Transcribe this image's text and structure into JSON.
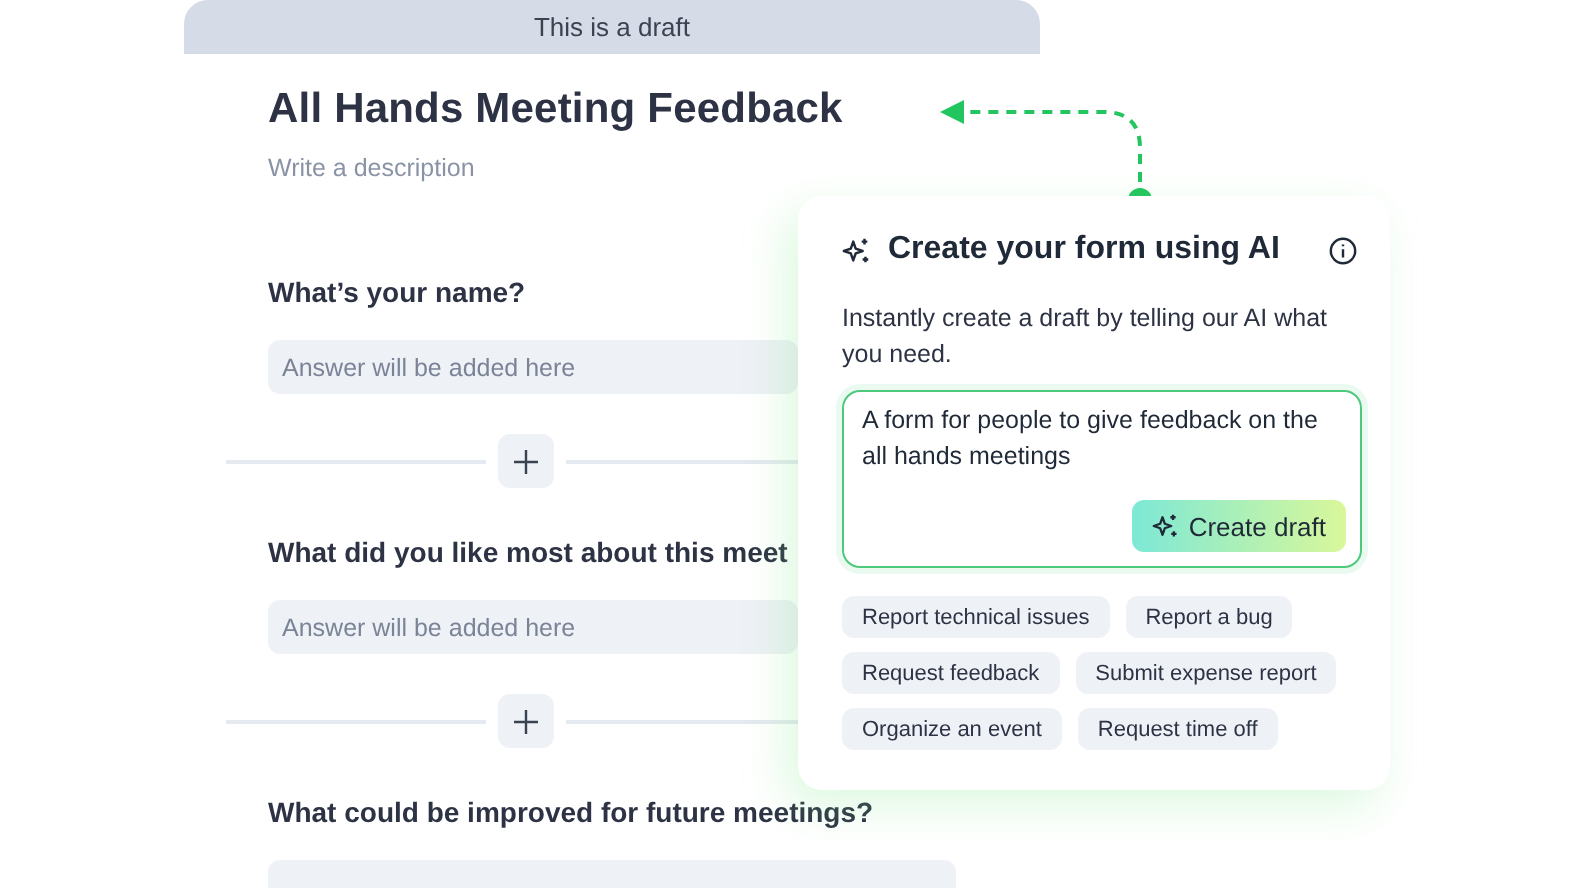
{
  "banner": "This is a draft",
  "form": {
    "title": "All Hands Meeting Feedback",
    "description_placeholder": "Write a description",
    "questions": [
      {
        "label": "What’s your name?",
        "placeholder": "Answer will be added here"
      },
      {
        "label": "What did you like most about this meet",
        "placeholder": "Answer will be added here"
      },
      {
        "label": "What could be improved for future meetings?"
      }
    ]
  },
  "ai_panel": {
    "title": "Create your form using AI",
    "description": "Instantly create a draft by telling our AI what you need.",
    "prompt": "A form for people to give feedback on the all hands meetings",
    "button": "Create draft",
    "suggestions": [
      "Report technical issues",
      "Report a bug",
      "Request feedback",
      "Submit expense report",
      "Organize an event",
      "Request time off"
    ]
  }
}
